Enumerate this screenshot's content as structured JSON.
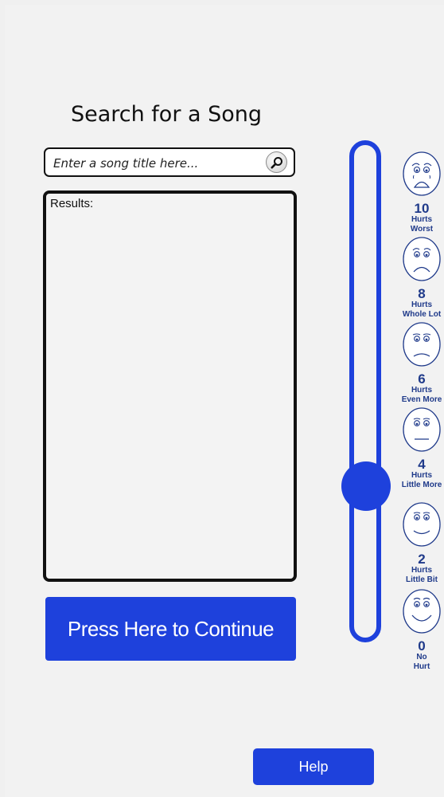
{
  "page": {
    "title": "Search for a Song"
  },
  "search": {
    "placeholder": "Enter a song title here...",
    "value": ""
  },
  "results": {
    "label": "Results:"
  },
  "buttons": {
    "continue_label": "Press Here to Continue",
    "help_label": "Help"
  },
  "pain_scale": {
    "selected_value": 3,
    "items": [
      {
        "value": "10",
        "line1": "Hurts",
        "line2": "Worst"
      },
      {
        "value": "8",
        "line1": "Hurts",
        "line2": "Whole Lot"
      },
      {
        "value": "6",
        "line1": "Hurts",
        "line2": "Even More"
      },
      {
        "value": "4",
        "line1": "Hurts",
        "line2": "Little More"
      },
      {
        "value": "2",
        "line1": "Hurts",
        "line2": "Little Bit"
      },
      {
        "value": "0",
        "line1": "No",
        "line2": "Hurt"
      }
    ]
  },
  "colors": {
    "accent": "#1e41dc",
    "scale_text": "#1f3a8a",
    "background": "#f2f2f2"
  }
}
